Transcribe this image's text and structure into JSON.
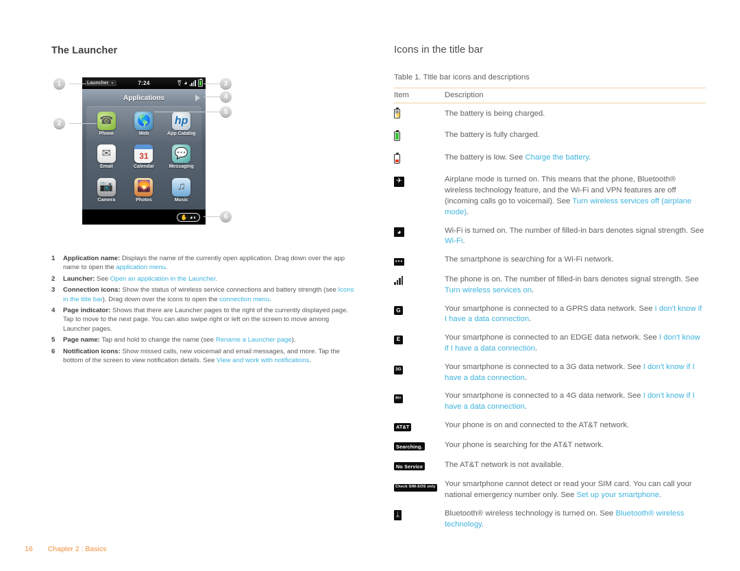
{
  "left": {
    "heading": "The Launcher",
    "figure": {
      "titlebar": {
        "app_name": "Launcher",
        "time": "7:24",
        "icons": [
          "bluetooth-icon",
          "wifi-icon",
          "signal-bars-icon",
          "battery-icon"
        ]
      },
      "page_name": "Applications",
      "apps": [
        {
          "label": "Phone",
          "icon": "phone-icon"
        },
        {
          "label": "Web",
          "icon": "globe-icon"
        },
        {
          "label": "App Catalog",
          "icon": "hp-bag-icon"
        },
        {
          "label": "Email",
          "icon": "envelope-icon"
        },
        {
          "label": "Calendar",
          "icon": "calendar-icon",
          "day": "31"
        },
        {
          "label": "Messaging",
          "icon": "speech-bubbles-icon"
        },
        {
          "label": "Camera",
          "icon": "camera-icon"
        },
        {
          "label": "Photos",
          "icon": "photos-icon"
        },
        {
          "label": "Music",
          "icon": "music-note-icon"
        }
      ],
      "callouts": [
        "1",
        "2",
        "3",
        "4",
        "5",
        "6"
      ]
    },
    "notes": [
      {
        "num": "1",
        "parts": [
          {
            "t": "Application name:",
            "s": "b"
          },
          {
            "t": " Displays the name of the currently open application. Drag down over the app name to open the ",
            "s": "n"
          },
          {
            "t": "application menu",
            "s": "l"
          },
          {
            "t": ".",
            "s": "n"
          }
        ]
      },
      {
        "num": "2",
        "parts": [
          {
            "t": "Launcher:",
            "s": "b"
          },
          {
            "t": " See ",
            "s": "n"
          },
          {
            "t": "Open an application in the Launcher",
            "s": "l"
          },
          {
            "t": ".",
            "s": "n"
          }
        ]
      },
      {
        "num": "3",
        "parts": [
          {
            "t": "Connection icons:",
            "s": "b"
          },
          {
            "t": " Show the status of wireless service connections and battery strength (see ",
            "s": "n"
          },
          {
            "t": "Icons in the title bar",
            "s": "l"
          },
          {
            "t": "). Drag down over the icons to open the ",
            "s": "n"
          },
          {
            "t": "connection menu",
            "s": "l"
          },
          {
            "t": ".",
            "s": "n"
          }
        ]
      },
      {
        "num": "4",
        "parts": [
          {
            "t": "Page indicator:",
            "s": "b"
          },
          {
            "t": " Shows that there are Launcher pages to the right of the currently displayed page. Tap to move to the next page. You can also swipe right or left on the screen to move among Launcher pages.",
            "s": "n"
          }
        ]
      },
      {
        "num": "5",
        "parts": [
          {
            "t": "Page name:",
            "s": "b"
          },
          {
            "t": " Tap and hold to change the name (see ",
            "s": "n"
          },
          {
            "t": "Rename a Launcher page",
            "s": "l"
          },
          {
            "t": ").",
            "s": "n"
          }
        ]
      },
      {
        "num": "6",
        "parts": [
          {
            "t": "Notification icons:",
            "s": "b"
          },
          {
            "t": " Show missed calls, new voicemail and email messages, and more. Tap the bottom of the screen to view notification details. See ",
            "s": "n"
          },
          {
            "t": "View and work with notifications",
            "s": "l"
          },
          {
            "t": ".",
            "s": "n"
          }
        ]
      }
    ]
  },
  "right": {
    "heading": "Icons in the title bar",
    "table_caption": "Table 1.  Title bar icons and descriptions",
    "columns": {
      "item": "Item",
      "description": "Description"
    },
    "rows": [
      {
        "icon": "battery-charging-icon",
        "parts": [
          {
            "t": "The battery is being charged.",
            "s": "n"
          }
        ]
      },
      {
        "icon": "battery-full-icon",
        "parts": [
          {
            "t": "The battery is fully charged.",
            "s": "n"
          }
        ]
      },
      {
        "icon": "battery-low-icon",
        "parts": [
          {
            "t": "The battery is low. See ",
            "s": "n"
          },
          {
            "t": "Charge the battery",
            "s": "l"
          },
          {
            "t": ".",
            "s": "n"
          }
        ]
      },
      {
        "icon": "airplane-mode-icon",
        "parts": [
          {
            "t": "Airplane mode is turned on. This means that the phone, Bluetooth® wireless technology feature, and the Wi-Fi and VPN features are off (incoming calls go to voicemail). See ",
            "s": "n"
          },
          {
            "t": "Turn wireless services off (airplane mode)",
            "s": "l"
          },
          {
            "t": ".",
            "s": "n"
          }
        ]
      },
      {
        "icon": "wifi-on-icon",
        "parts": [
          {
            "t": "Wi-Fi is turned on. The number of filled-in bars denotes signal strength. See ",
            "s": "n"
          },
          {
            "t": "Wi-Fi",
            "s": "l"
          },
          {
            "t": ".",
            "s": "n"
          }
        ]
      },
      {
        "icon": "wifi-searching-icon",
        "parts": [
          {
            "t": "The smartphone is searching for a Wi-Fi network.",
            "s": "n"
          }
        ]
      },
      {
        "icon": "signal-bars-icon",
        "parts": [
          {
            "t": "The phone is on. The number of filled-in bars denotes signal strength. See ",
            "s": "n"
          },
          {
            "t": "Turn wireless services on",
            "s": "l"
          },
          {
            "t": ".",
            "s": "n"
          }
        ]
      },
      {
        "icon": "gprs-icon",
        "chip_label": "G",
        "parts": [
          {
            "t": "Your smartphone is connected to a GPRS data network. See ",
            "s": "n"
          },
          {
            "t": "I don't know if I have a data connection",
            "s": "l"
          },
          {
            "t": ".",
            "s": "n"
          }
        ]
      },
      {
        "icon": "edge-icon",
        "chip_label": "E",
        "parts": [
          {
            "t": "Your smartphone is connected to an EDGE data network. See ",
            "s": "n"
          },
          {
            "t": "I don't know if I have a data connection",
            "s": "l"
          },
          {
            "t": ".",
            "s": "n"
          }
        ]
      },
      {
        "icon": "3g-icon",
        "chip_label": "3G",
        "parts": [
          {
            "t": "Your smartphone is connected to a 3G data network. See ",
            "s": "n"
          },
          {
            "t": "I don't know if I have a data connection",
            "s": "l"
          },
          {
            "t": ".",
            "s": "n"
          }
        ]
      },
      {
        "icon": "4g-icon",
        "chip_label": "H+",
        "parts": [
          {
            "t": "Your smartphone is connected to a 4G data network. See ",
            "s": "n"
          },
          {
            "t": "I don't know if I have a data connection",
            "s": "l"
          },
          {
            "t": ".",
            "s": "n"
          }
        ]
      },
      {
        "icon": "att-icon",
        "chip_label": "AT&T",
        "parts": [
          {
            "t": "Your phone is on and connected to the AT&T network.",
            "s": "n"
          }
        ]
      },
      {
        "icon": "searching-icon",
        "chip_label": "Searching.",
        "parts": [
          {
            "t": "Your phone is searching for the AT&T network.",
            "s": "n"
          }
        ]
      },
      {
        "icon": "no-service-icon",
        "chip_label": "No Service",
        "parts": [
          {
            "t": "The AT&T network is not available.",
            "s": "n"
          }
        ]
      },
      {
        "icon": "check-sim-icon",
        "chip_label": "Check SIM-SOS only",
        "parts": [
          {
            "t": "Your smartphone cannot detect or read your SIM card. You can call your national emergency number only. See ",
            "s": "n"
          },
          {
            "t": "Set up your smartphone",
            "s": "l"
          },
          {
            "t": ".",
            "s": "n"
          }
        ]
      },
      {
        "icon": "bluetooth-icon",
        "parts": [
          {
            "t": "Bluetooth® wireless technology is turned on. See ",
            "s": "n"
          },
          {
            "t": "Bluetooth® wireless technology",
            "s": "l"
          },
          {
            "t": ".",
            "s": "n"
          }
        ]
      }
    ]
  },
  "footer": {
    "page_number": "16",
    "chapter": "Chapter 2  :  Basics"
  },
  "colors": {
    "link": "#3db3dd",
    "footer": "#f0903a",
    "rule": "#f0cf9c",
    "body_text": "#5e5e5e"
  }
}
